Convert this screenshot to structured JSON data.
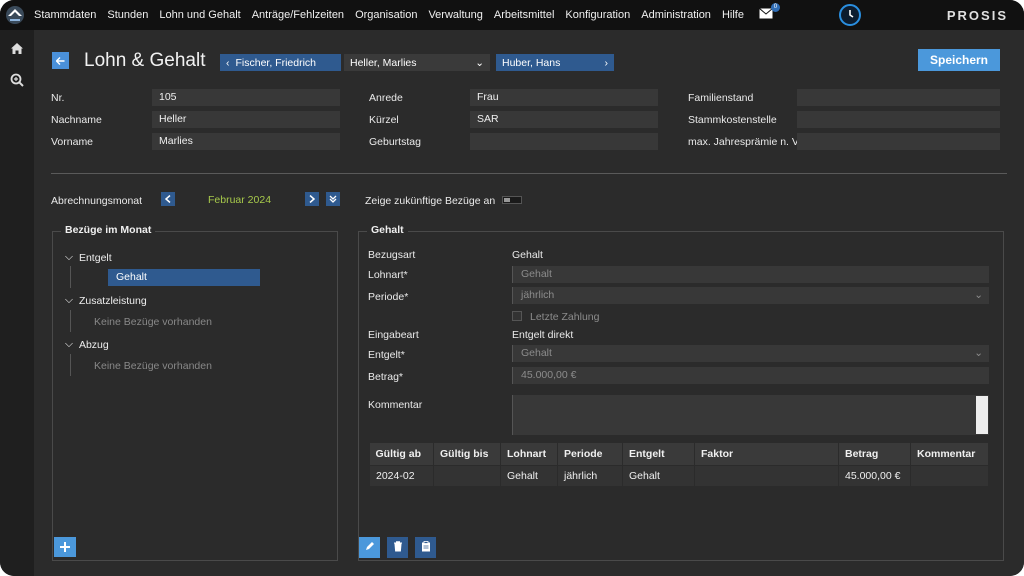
{
  "app": {
    "brand": "PROSIS",
    "mail_count": "0"
  },
  "menu": [
    "Stammdaten",
    "Stunden",
    "Lohn und Gehalt",
    "Anträge/Fehlzeiten",
    "Organisation",
    "Verwaltung",
    "Arbeitsmittel",
    "Konfiguration",
    "Administration",
    "Hilfe"
  ],
  "header": {
    "title": "Lohn & Gehalt",
    "prev_employee": "Fischer, Friedrich",
    "current_employee": "Heller, Marlies",
    "next_employee": "Huber, Hans",
    "save_label": "Speichern"
  },
  "employee": {
    "nr_label": "Nr.",
    "nr": "105",
    "nachname_label": "Nachname",
    "nachname": "Heller",
    "vorname_label": "Vorname",
    "vorname": "Marlies",
    "anrede_label": "Anrede",
    "anrede": "Frau",
    "kuerzel_label": "Kürzel",
    "kuerzel": "SAR",
    "geburtstag_label": "Geburtstag",
    "geburtstag": "",
    "familienstand_label": "Familienstand",
    "familienstand": "",
    "stammkostenstelle_label": "Stammkostenstelle",
    "stammkostenstelle": "",
    "jahrespraemie_label": "max. Jahresprämie n. V",
    "jahrespraemie": ""
  },
  "period": {
    "label": "Abrechnungsmonat",
    "month": "Februar 2024",
    "future_label": "Zeige zukünftige Bezüge an",
    "future_enabled": false
  },
  "left_panel": {
    "title": "Bezüge im Monat",
    "groups": [
      {
        "label": "Entgelt",
        "items": [
          "Gehalt"
        ]
      },
      {
        "label": "Zusatzleistung",
        "empty": "Keine Bezüge vorhanden"
      },
      {
        "label": "Abzug",
        "empty": "Keine Bezüge vorhanden"
      }
    ]
  },
  "right_panel": {
    "title": "Gehalt",
    "bezugsart_label": "Bezugsart",
    "bezugsart": "Gehalt",
    "lohnart_label": "Lohnart*",
    "lohnart": "Gehalt",
    "periode_label": "Periode*",
    "periode": "jährlich",
    "letzte_zahlung_label": "Letzte Zahlung",
    "eingabeart_label": "Eingabeart",
    "eingabeart": "Entgelt direkt",
    "entgelt_label": "Entgelt*",
    "entgelt": "Gehalt",
    "betrag_label": "Betrag*",
    "betrag": "45.000,00 €",
    "kommentar_label": "Kommentar",
    "kommentar": ""
  },
  "table": {
    "headers": [
      "Gültig ab",
      "Gültig bis",
      "Lohnart",
      "Periode",
      "Entgelt",
      "Faktor",
      "Betrag",
      "Kommentar"
    ],
    "rows": [
      [
        "2024-02",
        "",
        "Gehalt",
        "jährlich",
        "Gehalt",
        "",
        "45.000,00 €",
        ""
      ]
    ]
  },
  "colors": {
    "accent": "#4b98db",
    "nav_blue": "#2f5a8f",
    "month_green": "#a7c94b",
    "background": "#2b2b2b"
  }
}
